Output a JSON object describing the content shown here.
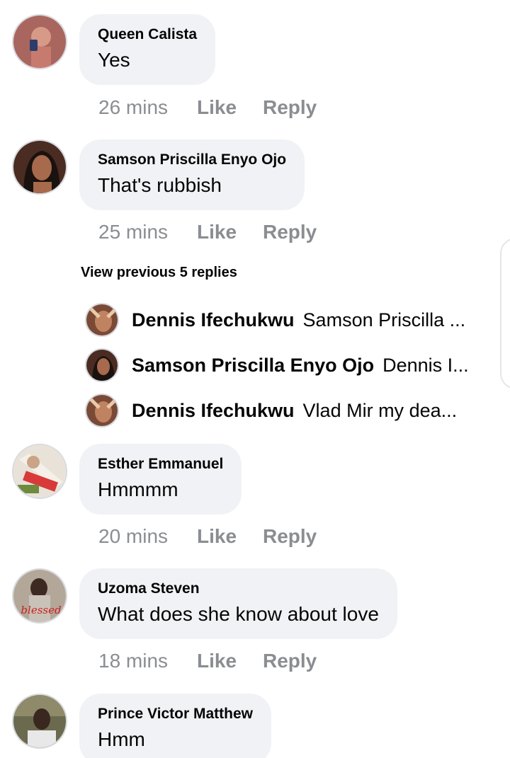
{
  "comments": [
    {
      "author": "Queen Calista",
      "text": "Yes",
      "time": "26 mins",
      "like": "Like",
      "reply": "Reply"
    },
    {
      "author": "Samson Priscilla Enyo Ojo",
      "text": "That's rubbish",
      "time": "25 mins",
      "like": "Like",
      "reply": "Reply"
    },
    {
      "author": "Esther Emmanuel",
      "text": "Hmmmm",
      "time": "20 mins",
      "like": "Like",
      "reply": "Reply"
    },
    {
      "author": "Uzoma Steven",
      "text": "What does she know about love",
      "time": "18 mins",
      "like": "Like",
      "reply": "Reply"
    },
    {
      "author": "Prince Victor Matthew",
      "text": "Hmm"
    }
  ],
  "replies_thread": {
    "view_previous": "View previous 5 replies",
    "items": [
      {
        "author": "Dennis Ifechukwu",
        "text": "Samson Priscilla ..."
      },
      {
        "author": "Samson Priscilla Enyo Ojo",
        "text": "Dennis I..."
      },
      {
        "author": "Dennis Ifechukwu",
        "text": "Vlad Mir  my dea..."
      }
    ]
  },
  "avatar_badge_text": "blessed",
  "colors": {
    "bubble": "#f0f2f5",
    "meta_text": "#8a8d91",
    "primary_text": "#050505"
  }
}
